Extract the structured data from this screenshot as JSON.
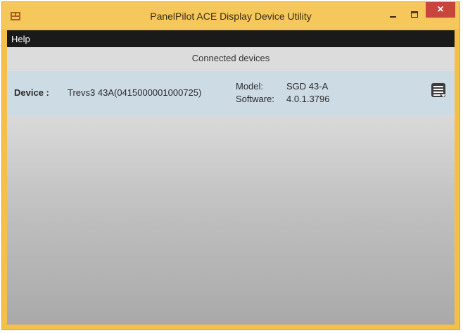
{
  "window": {
    "title": "PanelPilot ACE Display Device Utility",
    "controls": {
      "minimize_icon": "minimize-icon",
      "maximize_icon": "maximize-icon",
      "close_glyph": "×"
    }
  },
  "menubar": {
    "items": [
      {
        "label": "Help"
      }
    ]
  },
  "devices": {
    "header": "Connected devices",
    "items": [
      {
        "device_label": "Device :",
        "device_name": "Trevs3 43A(0415000001000725)",
        "model_label": "Model:",
        "model_value": "SGD 43-A",
        "software_label": "Software:",
        "software_value": "4.0.1.3796",
        "menu_icon": "device-menu-icon"
      }
    ]
  },
  "colors": {
    "title_bar": "#f6c85c",
    "menu_bar": "#1a1a1a",
    "device_row": "#cddbe4",
    "close_button": "#c7453c"
  }
}
